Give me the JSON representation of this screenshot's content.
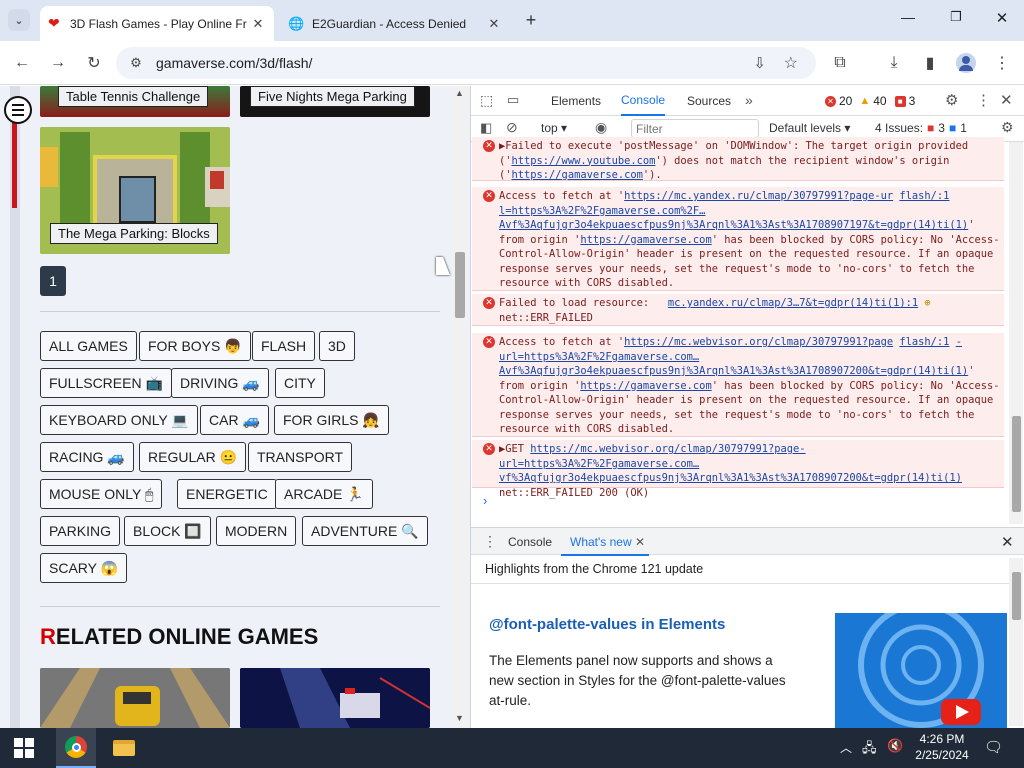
{
  "tabs": [
    {
      "title": "3D Flash Games - Play Online Fr",
      "active": true
    },
    {
      "title": "E2Guardian - Access Denied",
      "active": false
    }
  ],
  "address": {
    "url": "gamaverse.com/3d/flash/"
  },
  "page": {
    "top_games": [
      {
        "label": "Table Tennis Challenge"
      },
      {
        "label": "Five Nights Mega Parking"
      }
    ],
    "game_blocks": {
      "label": "The Mega Parking: Blocks"
    },
    "pagination": {
      "current": "1"
    },
    "tags": [
      "ALL GAMES",
      "FOR BOYS 👦",
      "FLASH",
      "3D",
      "FULLSCREEN 📺",
      "DRIVING 🚙",
      "CITY",
      "KEYBOARD ONLY 💻",
      "CAR 🚙",
      "FOR GIRLS 👧",
      "RACING 🚙",
      "REGULAR 😐",
      "TRANSPORT",
      "MOUSE ONLY 🖱",
      "ENERGETIC",
      "ARCADE 🏃",
      "PARKING",
      "BLOCK 🔲",
      "MODERN",
      "ADVENTURE 🔍",
      "SCARY 😱"
    ],
    "related": {
      "first_letter": "R",
      "rest": "ELATED ONLINE GAMES"
    }
  },
  "devtools": {
    "tabs": [
      "Elements",
      "Console",
      "Sources"
    ],
    "active_tab": "Console",
    "counts": {
      "errors": "20",
      "warnings": "40",
      "issues_badge": "3"
    },
    "console_toolbar": {
      "context": "top",
      "filter_placeholder": "Filter",
      "levels": "Default levels",
      "issues_label": "4 Issues:",
      "issues_err": "3",
      "issues_info": "1"
    },
    "messages": [
      {
        "pre": "▶Failed to execute 'postMessage' on 'DOMWindow': The target origin provided ('",
        "l1": "https://www.youtube.com",
        "mid": "') does not match the recipient window's origin ('",
        "l2": "https://gamaverse.com",
        "post": "')."
      },
      {
        "pre": "Access to fetch at '",
        "l1": "https://mc.yandex.ru/clmap/30797991?page-ur",
        "side": "flash/:1",
        "l1b": "l=https%3A%2F%2Fgamaverse.com%2F…Avf%3Aqfujgr3o4ekpuaescfpus9nj%3Arqnl%3A1%3Ast%3A1708907197&t=gdpr(14)ti(1)",
        "mid": "' from origin '",
        "l2": "https://gamaverse.com",
        "post": "' has been blocked by CORS policy: No 'Access-Control-Allow-Origin' header is present on the requested resource. If an opaque response serves your needs, set the request's mode to 'no-cors' to fetch the resource with CORS disabled."
      },
      {
        "pre": "Failed to load resource:",
        "l1": "mc.yandex.ru/clmap/3…7&t=gdpr(14)ti(1):1",
        "post": "net::ERR_FAILED"
      },
      {
        "pre": "Access to fetch at '",
        "l1": "https://mc.webvisor.org/clmap/30797991?page",
        "side": "flash/:1",
        "l1b": "-url=https%3A%2F%2Fgamaverse.com…Avf%3Aqfujgr3o4ekpuaescfpus9nj%3Arqnl%3A1%3Ast%3A1708907200&t=gdpr(14)ti(1)",
        "mid": "' from origin '",
        "l2": "https://gamaverse.com",
        "post": "' has been blocked by CORS policy: No 'Access-Control-Allow-Origin' header is present on the requested resource. If an opaque response serves your needs, set the request's mode to 'no-cors' to fetch the resource with CORS disabled."
      },
      {
        "pre": "▶GET",
        "l1": "https://mc.webvisor.org/clmap/30797991?page-url=https%3A%2F%2Fgamaverse.com…vf%3Aqfujgr3o4ekpuaescfpus9nj%3Arqnl%3A1%3Ast%3A1708907200&t=gdpr(14)ti(1)",
        "post": "net::ERR_FAILED 200 (OK)"
      }
    ],
    "drawer": {
      "tabs": [
        "Console",
        "What's new"
      ],
      "active": "What's new",
      "highlights": "Highlights from the Chrome 121 update",
      "heading": "@font-palette-values in Elements",
      "body": "The Elements panel now supports and shows a new section in Styles for the @font-palette-values at-rule."
    }
  },
  "taskbar": {
    "time": "4:26 PM",
    "date": "2/25/2024"
  },
  "colors": {
    "accent": "#1a73e8",
    "error": "#dc362e",
    "warning": "#e8a100",
    "related_r": "#d20000"
  }
}
